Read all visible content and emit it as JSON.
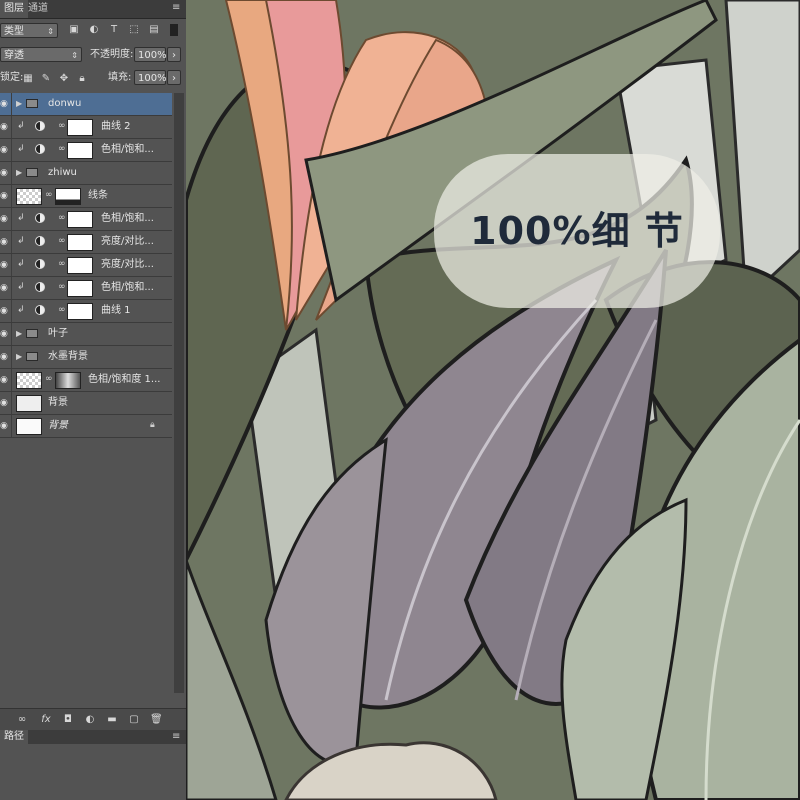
{
  "panel": {
    "tabs": [
      {
        "label": "图层"
      },
      {
        "label": "通道"
      }
    ],
    "filter_kind": "类型",
    "blend_mode": "穿透",
    "opacity_label": "不透明度:",
    "opacity_value": "100%",
    "lock_label": "锁定:",
    "fill_label": "填充:",
    "fill_value": "100%"
  },
  "layers": [
    {
      "name": "donwu",
      "kind": "group",
      "selected": true
    },
    {
      "name": "曲线 2",
      "kind": "adjustment"
    },
    {
      "name": "色相/饱和...",
      "kind": "adjustment"
    },
    {
      "name": "zhiwu",
      "kind": "group"
    },
    {
      "name": "线条",
      "kind": "image-mask"
    },
    {
      "name": "色相/饱和...",
      "kind": "adjustment"
    },
    {
      "name": "亮度/对比...",
      "kind": "adjustment"
    },
    {
      "name": "亮度/对比...",
      "kind": "adjustment"
    },
    {
      "name": "色相/饱和...",
      "kind": "adjustment"
    },
    {
      "name": "曲线 1",
      "kind": "adjustment"
    },
    {
      "name": "叶子",
      "kind": "group"
    },
    {
      "name": "水墨背景",
      "kind": "group"
    },
    {
      "name": "色相/饱和度 1...",
      "kind": "image-mask"
    },
    {
      "name": "背景",
      "kind": "image"
    },
    {
      "name": "背景",
      "kind": "background",
      "locked": true
    }
  ],
  "paths_panel": {
    "tab_label": "路径"
  },
  "canvas": {
    "badge_text": "100%细 节",
    "colors": {
      "dark_leaf": "#5f6651",
      "mauve_leaf": "#8f8690",
      "sage_leaf": "#a9b3a0",
      "orange_petal": "#e8a880",
      "pink_petal": "#e89a9a",
      "selection_blue": "#4e6e94"
    }
  },
  "icons": [
    "eye-icon",
    "folder-icon",
    "chain-link-icon",
    "adjustment-icon",
    "lock-icon",
    "link-layers-icon",
    "fx-icon",
    "mask-icon",
    "new-group-icon",
    "new-layer-icon",
    "trash-icon"
  ]
}
